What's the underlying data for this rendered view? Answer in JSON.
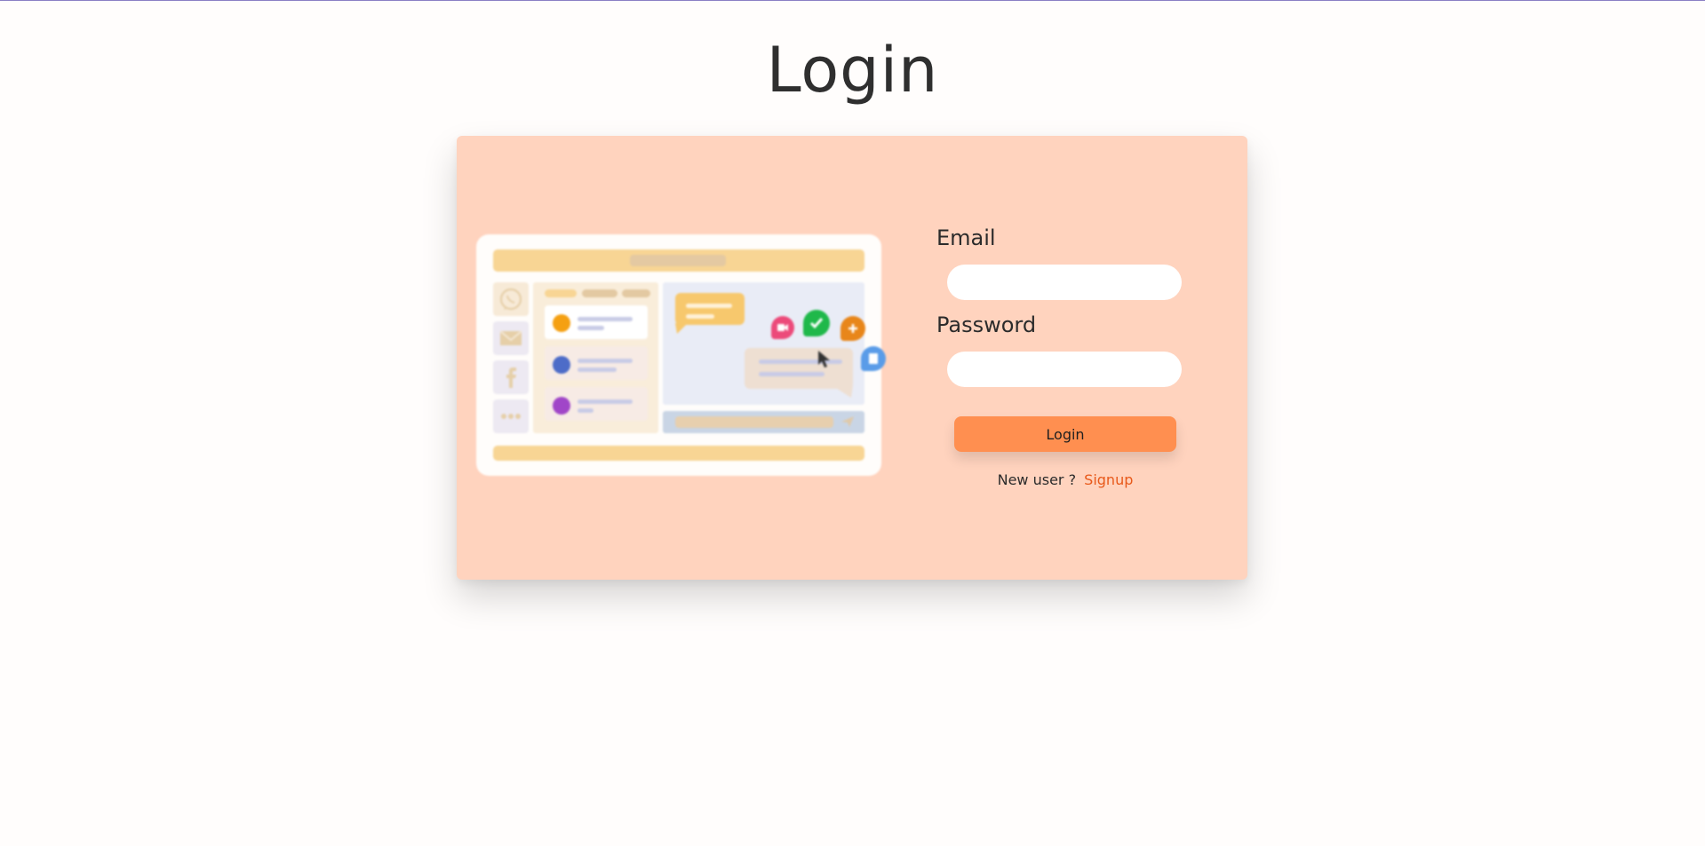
{
  "page": {
    "title": "Login"
  },
  "illustration": {
    "icons": [
      "whatsapp-icon",
      "mail-icon",
      "facebook-icon",
      "more-icon",
      "video-icon",
      "check-icon",
      "plus-icon",
      "file-icon",
      "cursor-icon",
      "send-icon"
    ],
    "colors": {
      "accent_bar": "#f8d594",
      "bubble": "#f7c86d",
      "pin_pink": "#ec4a7a",
      "pin_green": "#1fb84a",
      "pin_orange": "#e8861a",
      "pin_blue": "#5a9ce8"
    }
  },
  "form": {
    "email_label": "Email",
    "email_value": "",
    "password_label": "Password",
    "password_value": "",
    "login_label": "Login",
    "new_user_text": "New user ?",
    "signup_label": "Signup"
  },
  "colors": {
    "background": "#fffdfc",
    "card": "#ffd3be",
    "button": "#ff8f50",
    "link": "#e8591a"
  }
}
